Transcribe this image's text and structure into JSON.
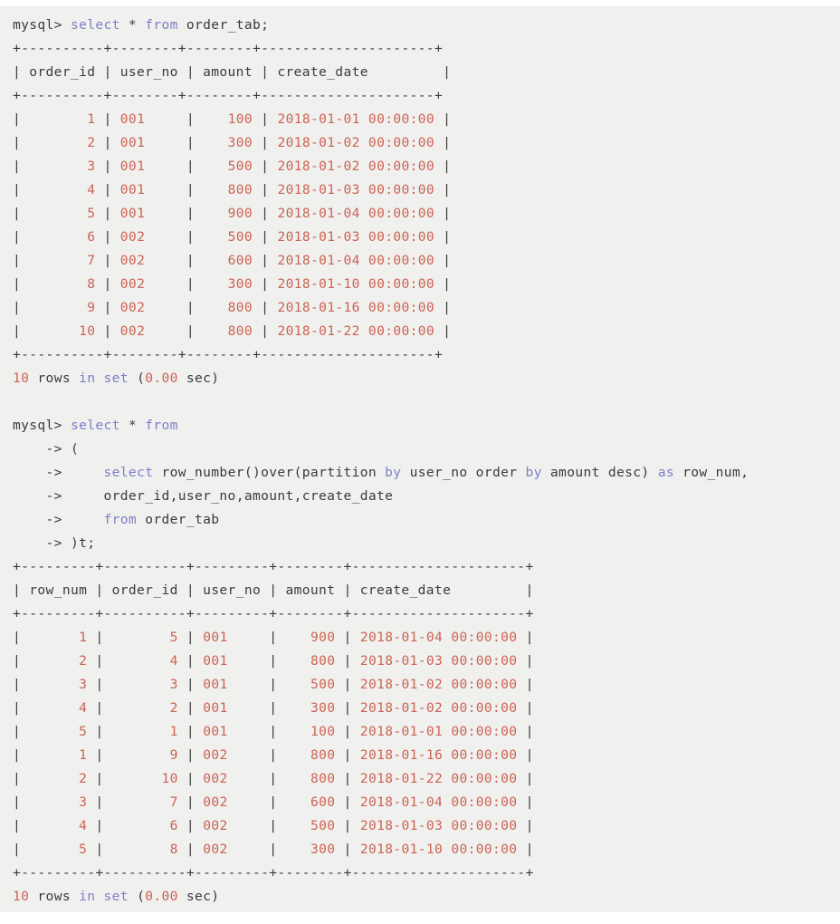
{
  "terminal": {
    "background_color": "#f0f0ef",
    "text_color": "#3b3b3b",
    "keyword_color": "#7c80c6",
    "value_color": "#cc6352",
    "prompt": "mysql>",
    "continuation_prompt": "->"
  },
  "block1": {
    "command_line": {
      "prompt": "mysql>",
      "keyword1": "select",
      "star": " * ",
      "keyword2": "from",
      "table": " order_tab;"
    },
    "rule": "+----------+--------+--------+---------------------+",
    "header": "| order_id | user_no | amount | create_date         |",
    "header_cells": [
      "order_id",
      "user_no",
      "amount",
      "create_date"
    ],
    "rows": [
      {
        "order_id": "1",
        "user_no": "001",
        "amount": "100",
        "create_date": "2018-01-01 00:00:00"
      },
      {
        "order_id": "2",
        "user_no": "001",
        "amount": "300",
        "create_date": "2018-01-02 00:00:00"
      },
      {
        "order_id": "3",
        "user_no": "001",
        "amount": "500",
        "create_date": "2018-01-02 00:00:00"
      },
      {
        "order_id": "4",
        "user_no": "001",
        "amount": "800",
        "create_date": "2018-01-03 00:00:00"
      },
      {
        "order_id": "5",
        "user_no": "001",
        "amount": "900",
        "create_date": "2018-01-04 00:00:00"
      },
      {
        "order_id": "6",
        "user_no": "002",
        "amount": "500",
        "create_date": "2018-01-03 00:00:00"
      },
      {
        "order_id": "7",
        "user_no": "002",
        "amount": "600",
        "create_date": "2018-01-04 00:00:00"
      },
      {
        "order_id": "8",
        "user_no": "002",
        "amount": "300",
        "create_date": "2018-01-10 00:00:00"
      },
      {
        "order_id": "9",
        "user_no": "002",
        "amount": "800",
        "create_date": "2018-01-16 00:00:00"
      },
      {
        "order_id": "10",
        "user_no": "002",
        "amount": "800",
        "create_date": "2018-01-22 00:00:00"
      }
    ],
    "status": {
      "count": "10",
      "rows_word": " rows ",
      "in_set": "in set",
      "paren_open": " (",
      "seconds": "0.00",
      "sec_close": " sec)"
    }
  },
  "block2": {
    "command_lines": [
      {
        "prompt": "mysql>",
        "segments": [
          {
            "text": " ",
            "type": "plain"
          },
          {
            "text": "select",
            "type": "kw"
          },
          {
            "text": " * ",
            "type": "plain"
          },
          {
            "text": "from",
            "type": "kw"
          }
        ]
      },
      {
        "prompt": "    ->",
        "segments": [
          {
            "text": " (",
            "type": "plain"
          }
        ]
      },
      {
        "prompt": "    ->",
        "segments": [
          {
            "text": "     ",
            "type": "plain"
          },
          {
            "text": "select",
            "type": "kw"
          },
          {
            "text": " row_number()over(partition ",
            "type": "plain"
          },
          {
            "text": "by",
            "type": "kw"
          },
          {
            "text": " user_no order ",
            "type": "plain"
          },
          {
            "text": "by",
            "type": "kw"
          },
          {
            "text": " amount desc) ",
            "type": "plain"
          },
          {
            "text": "as",
            "type": "kw"
          },
          {
            "text": " row_num,",
            "type": "plain"
          }
        ]
      },
      {
        "prompt": "    ->",
        "segments": [
          {
            "text": "     order_id,user_no,amount,create_date",
            "type": "plain"
          }
        ]
      },
      {
        "prompt": "    ->",
        "segments": [
          {
            "text": "     ",
            "type": "plain"
          },
          {
            "text": "from",
            "type": "kw"
          },
          {
            "text": " order_tab",
            "type": "plain"
          }
        ]
      },
      {
        "prompt": "    ->",
        "segments": [
          {
            "text": " )t;",
            "type": "plain"
          }
        ]
      }
    ],
    "rule": "+---------+----------+---------+--------+---------------------+",
    "header": "| row_num | order_id | user_no | amount | create_date         |",
    "header_cells": [
      "row_num",
      "order_id",
      "user_no",
      "amount",
      "create_date"
    ],
    "rows": [
      {
        "row_num": "1",
        "order_id": "5",
        "user_no": "001",
        "amount": "900",
        "create_date": "2018-01-04 00:00:00"
      },
      {
        "row_num": "2",
        "order_id": "4",
        "user_no": "001",
        "amount": "800",
        "create_date": "2018-01-03 00:00:00"
      },
      {
        "row_num": "3",
        "order_id": "3",
        "user_no": "001",
        "amount": "500",
        "create_date": "2018-01-02 00:00:00"
      },
      {
        "row_num": "4",
        "order_id": "2",
        "user_no": "001",
        "amount": "300",
        "create_date": "2018-01-02 00:00:00"
      },
      {
        "row_num": "5",
        "order_id": "1",
        "user_no": "001",
        "amount": "100",
        "create_date": "2018-01-01 00:00:00"
      },
      {
        "row_num": "1",
        "order_id": "9",
        "user_no": "002",
        "amount": "800",
        "create_date": "2018-01-16 00:00:00"
      },
      {
        "row_num": "2",
        "order_id": "10",
        "user_no": "002",
        "amount": "800",
        "create_date": "2018-01-22 00:00:00"
      },
      {
        "row_num": "3",
        "order_id": "7",
        "user_no": "002",
        "amount": "600",
        "create_date": "2018-01-04 00:00:00"
      },
      {
        "row_num": "4",
        "order_id": "6",
        "user_no": "002",
        "amount": "500",
        "create_date": "2018-01-03 00:00:00"
      },
      {
        "row_num": "5",
        "order_id": "8",
        "user_no": "002",
        "amount": "300",
        "create_date": "2018-01-10 00:00:00"
      }
    ],
    "status": {
      "count": "10",
      "rows_word": " rows ",
      "in_set": "in set",
      "paren_open": " (",
      "seconds": "0.00",
      "sec_close": " sec)"
    }
  }
}
